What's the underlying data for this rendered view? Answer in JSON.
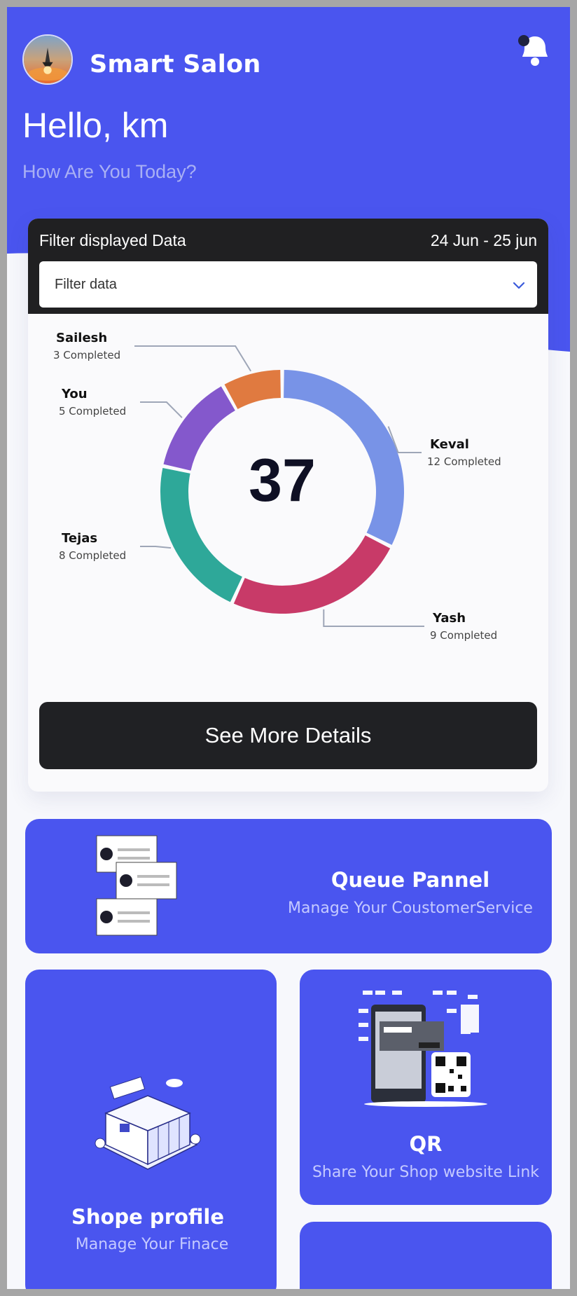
{
  "header": {
    "app_title": "Smart Salon",
    "greeting": "Hello, km",
    "subgreeting": "How Are You Today?"
  },
  "filter_card": {
    "label": "Filter displayed Data",
    "date_range": "24 Jun - 25 jun",
    "select_placeholder": "Filter data",
    "see_more_label": "See More Details"
  },
  "chart_data": {
    "type": "pie",
    "total_label": "37",
    "series": [
      {
        "name": "Keval",
        "label": "12 Completed",
        "value": 12,
        "color": "#7893e7"
      },
      {
        "name": "Yash",
        "label": "9 Completed",
        "value": 9,
        "color": "#c83a68"
      },
      {
        "name": "Tejas",
        "label": "8 Completed",
        "value": 8,
        "color": "#2ea899"
      },
      {
        "name": "You",
        "label": "5 Completed",
        "value": 5,
        "color": "#8458cc"
      },
      {
        "name": "Sailesh",
        "label": "3 Completed",
        "value": 3,
        "color": "#e07a40"
      }
    ]
  },
  "tiles": {
    "queue": {
      "title": "Queue Pannel",
      "subtitle": "Manage Your CoustomerService"
    },
    "profile": {
      "title": "Shope profile",
      "subtitle": "Manage Your Finace"
    },
    "qr": {
      "title": "QR",
      "subtitle": "Share Your Shop website Link"
    }
  },
  "colors": {
    "primary": "#4a55ef",
    "dark": "#202022"
  },
  "icons": [
    "notification-bell-icon",
    "chevron-down-icon"
  ]
}
